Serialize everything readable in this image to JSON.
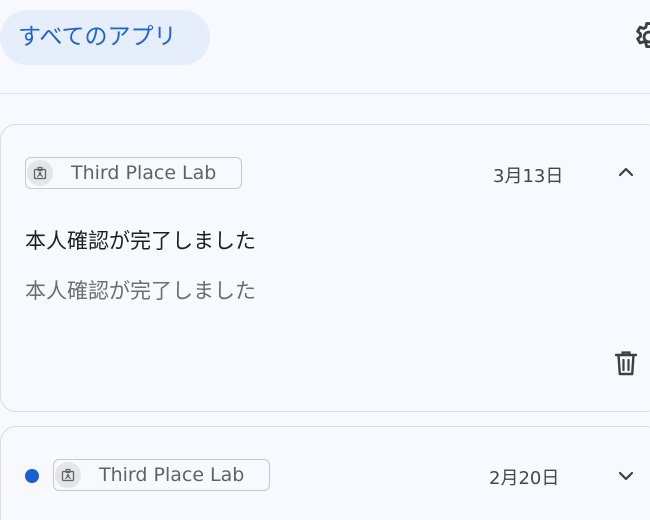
{
  "header": {
    "filter_label": "すべてのアプリ",
    "settings_icon": "gear-icon"
  },
  "notifications": [
    {
      "app_name": "Third Place Lab",
      "app_icon": "app-badge-icon",
      "date": "3月13日",
      "expanded": true,
      "unread": false,
      "title": "本人確認が完了しました",
      "body": "本人確認が完了しました",
      "toggle_icon": "chevron-up-icon",
      "delete_icon": "trash-icon"
    },
    {
      "app_name": "Third Place Lab",
      "app_icon": "app-badge-icon",
      "date": "2月20日",
      "expanded": false,
      "unread": true,
      "toggle_icon": "chevron-down-icon"
    }
  ],
  "colors": {
    "accent": "#1f63d8",
    "chip_background": "#e6edfb",
    "page_background": "#f8f9fe",
    "unread_dot": "#1a5fd6"
  }
}
